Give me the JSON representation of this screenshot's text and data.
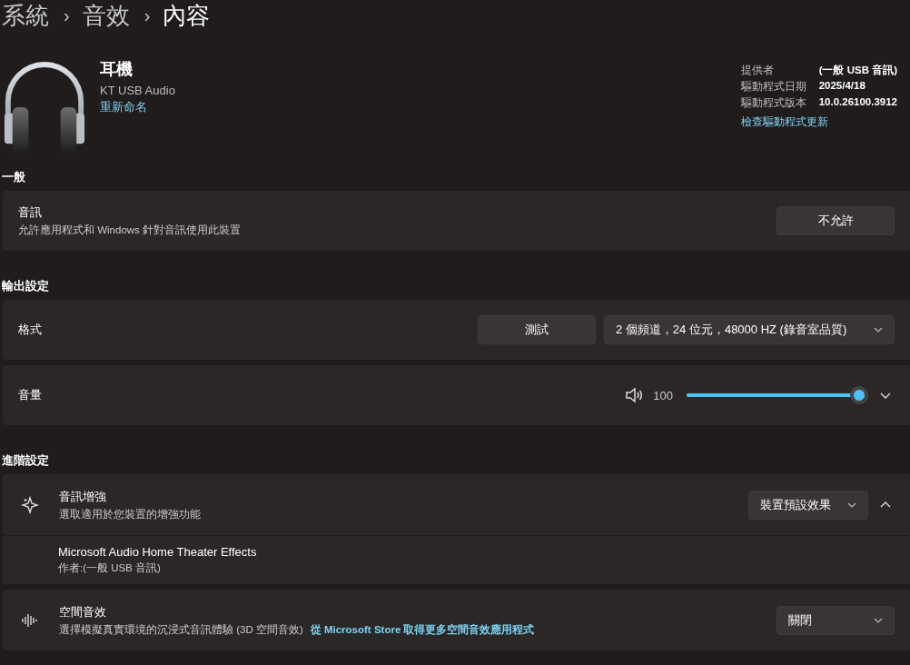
{
  "breadcrumb": {
    "separator": "›",
    "items": [
      {
        "text": "系統",
        "current": false
      },
      {
        "text": "音效",
        "current": false
      },
      {
        "text": "內容",
        "current": true
      }
    ]
  },
  "device": {
    "name": "耳機",
    "model": "KT USB Audio",
    "rename_link": "重新命名"
  },
  "driver": {
    "rows": [
      {
        "label": "提供者",
        "value": "(一般 USB 音訊)"
      },
      {
        "label": "驅動程式日期",
        "value": "2025/4/18"
      },
      {
        "label": "驅動程式版本",
        "value": "10.0.26100.3912"
      }
    ],
    "link": "檢查驅動程式更新"
  },
  "general": {
    "title": "一般",
    "audio": {
      "title": "音訊",
      "description": "允許應用程式和 Windows 針對音訊使用此裝置",
      "button": "不允許"
    }
  },
  "output": {
    "title": "輸出設定",
    "format": {
      "label": "格式",
      "test_button": "測試",
      "dropdown": "2 個頻道，24 位元，48000 HZ (錄音室品質)"
    },
    "volume": {
      "label": "音量",
      "reading": "100",
      "level": 1.0,
      "expanded": false
    }
  },
  "advanced": {
    "title": "進階設定",
    "enhancement": {
      "title": "音訊增強",
      "description": "選取適用於您裝置的增強功能",
      "dropdown": "裝置預設效果",
      "expanded": true,
      "effects": [
        {
          "name": "Microsoft Audio Home Theater Effects",
          "author": "作者:(一般 USB 音訊)"
        }
      ]
    },
    "spatial": {
      "title": "空間音效",
      "description": "選擇模擬真實環境的沉浸式音訊體驗 (3D 空間音效)",
      "link": "從 Microsoft Store 取得更多空間音效應用程式",
      "dropdown": "關閉"
    }
  }
}
